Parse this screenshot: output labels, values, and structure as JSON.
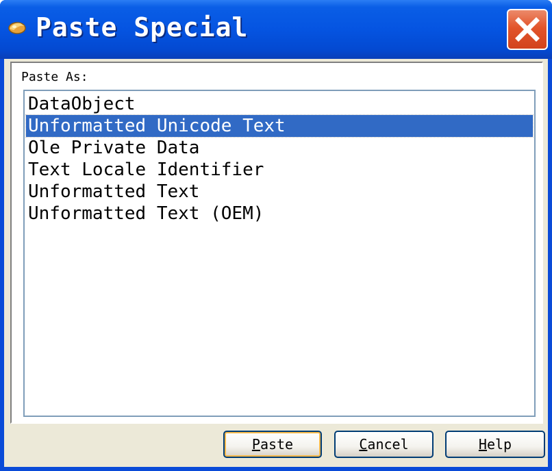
{
  "window": {
    "title": "Paste Special",
    "icon": "pencil-eraser-icon",
    "close_icon": "close-icon"
  },
  "paste_as": {
    "label": "Paste As:",
    "items": [
      {
        "label": "DataObject",
        "selected": false
      },
      {
        "label": "Unformatted Unicode Text",
        "selected": true
      },
      {
        "label": "Ole Private Data",
        "selected": false
      },
      {
        "label": "Text Locale Identifier",
        "selected": false
      },
      {
        "label": "Unformatted Text",
        "selected": false
      },
      {
        "label": "Unformatted Text (OEM)",
        "selected": false
      }
    ]
  },
  "buttons": {
    "paste": {
      "accel": "P",
      "rest": "aste"
    },
    "cancel": {
      "accel": "C",
      "rest": "ancel"
    },
    "help": {
      "accel": "H",
      "rest": "elp"
    }
  },
  "colors": {
    "titlebar": "#0554e1",
    "selection": "#316ac5",
    "close_button": "#e2542b"
  }
}
